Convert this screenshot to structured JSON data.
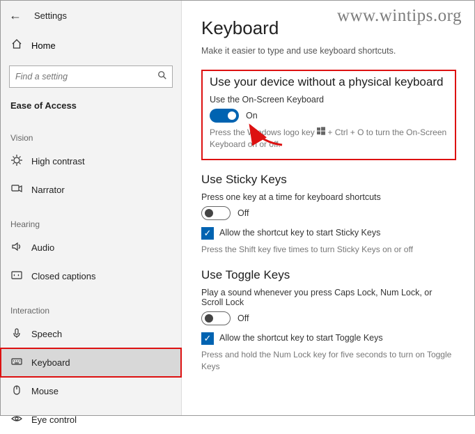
{
  "watermark": "www.wintips.org",
  "window": {
    "title": "Settings"
  },
  "sidebar": {
    "home": "Home",
    "search_placeholder": "Find a setting",
    "current_section": "Ease of Access",
    "groups": [
      {
        "label": "Vision",
        "items": [
          {
            "label": "High contrast"
          },
          {
            "label": "Narrator"
          }
        ]
      },
      {
        "label": "Hearing",
        "items": [
          {
            "label": "Audio"
          },
          {
            "label": "Closed captions"
          }
        ]
      },
      {
        "label": "Interaction",
        "items": [
          {
            "label": "Speech"
          },
          {
            "label": "Keyboard"
          },
          {
            "label": "Mouse"
          },
          {
            "label": "Eye control"
          }
        ]
      }
    ]
  },
  "main": {
    "title": "Keyboard",
    "subtitle": "Make it easier to type and use keyboard shortcuts.",
    "section1": {
      "heading": "Use your device without a physical keyboard",
      "toggle_caption": "Use the On-Screen Keyboard",
      "toggle_state": "On",
      "hint_prefix": "Press the Windows logo key ",
      "hint_suffix": " + Ctrl + O to turn the On-Screen Keyboard on or off."
    },
    "section2": {
      "heading": "Use Sticky Keys",
      "toggle_caption": "Press one key at a time for keyboard shortcuts",
      "toggle_state": "Off",
      "checkbox_label": "Allow the shortcut key to start Sticky Keys",
      "hint": "Press the Shift key five times to turn Sticky Keys on or off"
    },
    "section3": {
      "heading": "Use Toggle Keys",
      "toggle_caption": "Play a sound whenever you press Caps Lock, Num Lock, or Scroll Lock",
      "toggle_state": "Off",
      "checkbox_label": "Allow the shortcut key to start Toggle Keys",
      "hint": "Press and hold the Num Lock key for five seconds to turn on Toggle Keys"
    }
  }
}
